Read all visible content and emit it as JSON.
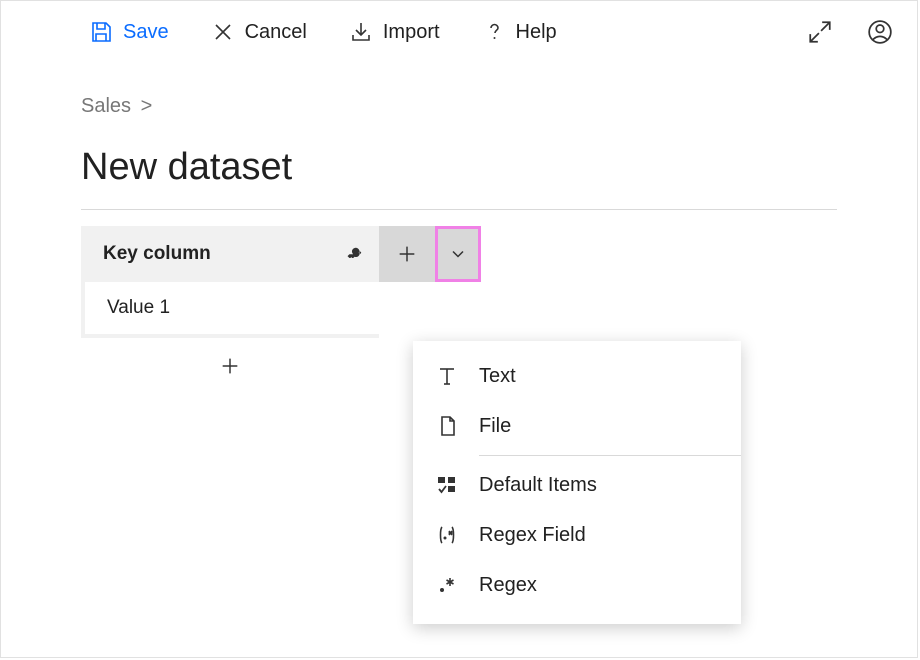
{
  "toolbar": {
    "save": "Save",
    "cancel": "Cancel",
    "import": "Import",
    "help": "Help"
  },
  "breadcrumb": {
    "root": "Sales",
    "sep": ">"
  },
  "title": "New dataset",
  "dataset": {
    "key_column_header": "Key column",
    "rows": [
      "Value 1"
    ]
  },
  "column_type_menu": {
    "text": "Text",
    "file": "File",
    "default_items": "Default Items",
    "regex_field": "Regex Field",
    "regex": "Regex"
  }
}
